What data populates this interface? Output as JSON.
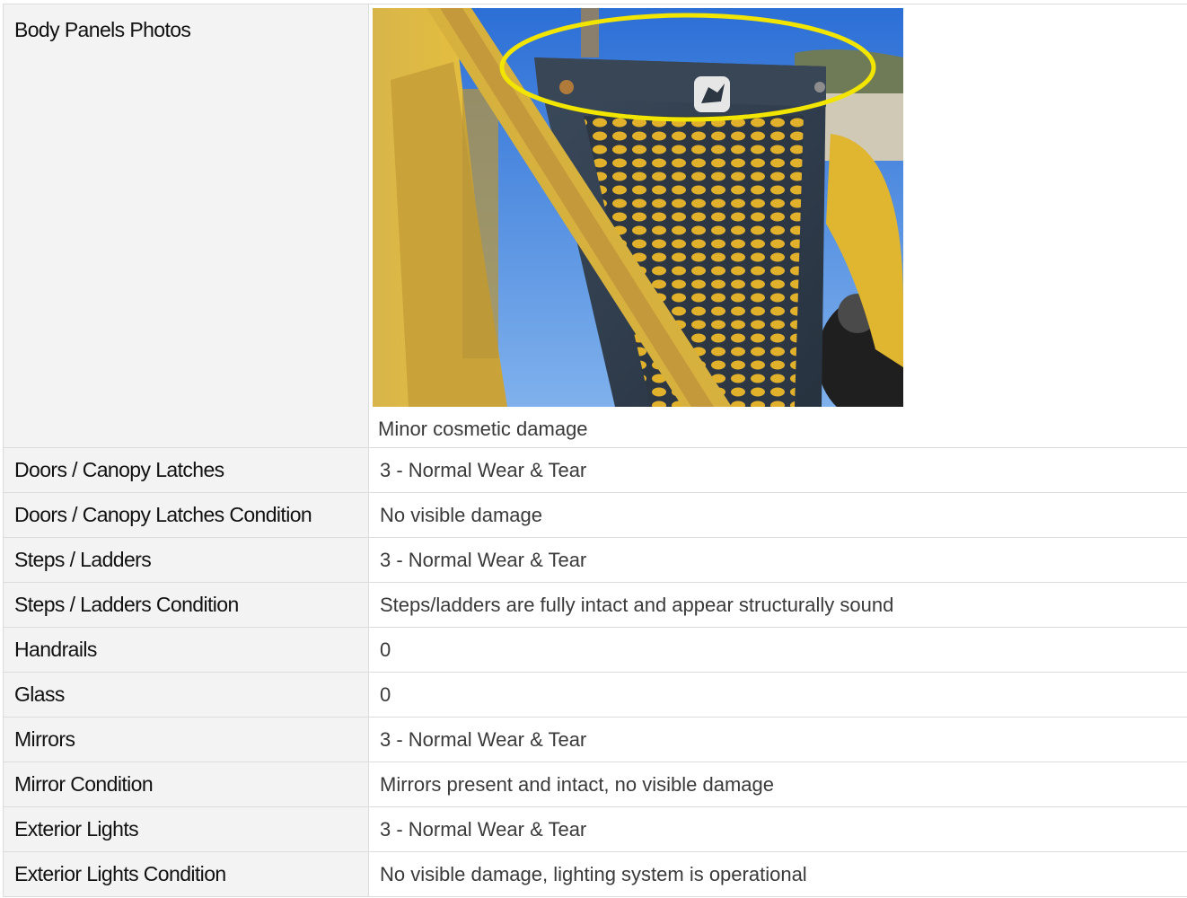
{
  "photo_row": {
    "label": "Body Panels Photos",
    "caption": "Minor cosmetic damage",
    "photo_icon": "machine-panel-photo"
  },
  "rows": [
    {
      "label": "Doors / Canopy Latches",
      "value": "3 - Normal Wear & Tear"
    },
    {
      "label": "Doors / Canopy Latches Condition",
      "value": "No visible damage"
    },
    {
      "label": "Steps / Ladders",
      "value": "3 - Normal Wear & Tear"
    },
    {
      "label": "Steps / Ladders Condition",
      "value": "Steps/ladders are fully intact and appear structurally sound"
    },
    {
      "label": "Handrails",
      "value": "0"
    },
    {
      "label": "Glass",
      "value": "0"
    },
    {
      "label": "Mirrors",
      "value": "3 - Normal Wear & Tear"
    },
    {
      "label": "Mirror Condition",
      "value": "Mirrors present and intact, no visible damage"
    },
    {
      "label": "Exterior Lights",
      "value": "3 - Normal Wear & Tear"
    },
    {
      "label": "Exterior Lights Condition",
      "value": "No visible damage, lighting system is operational"
    }
  ],
  "colors": {
    "label_bg": "#f3f3f3",
    "border": "#dcdcdc",
    "highlight": "#f2e600"
  }
}
